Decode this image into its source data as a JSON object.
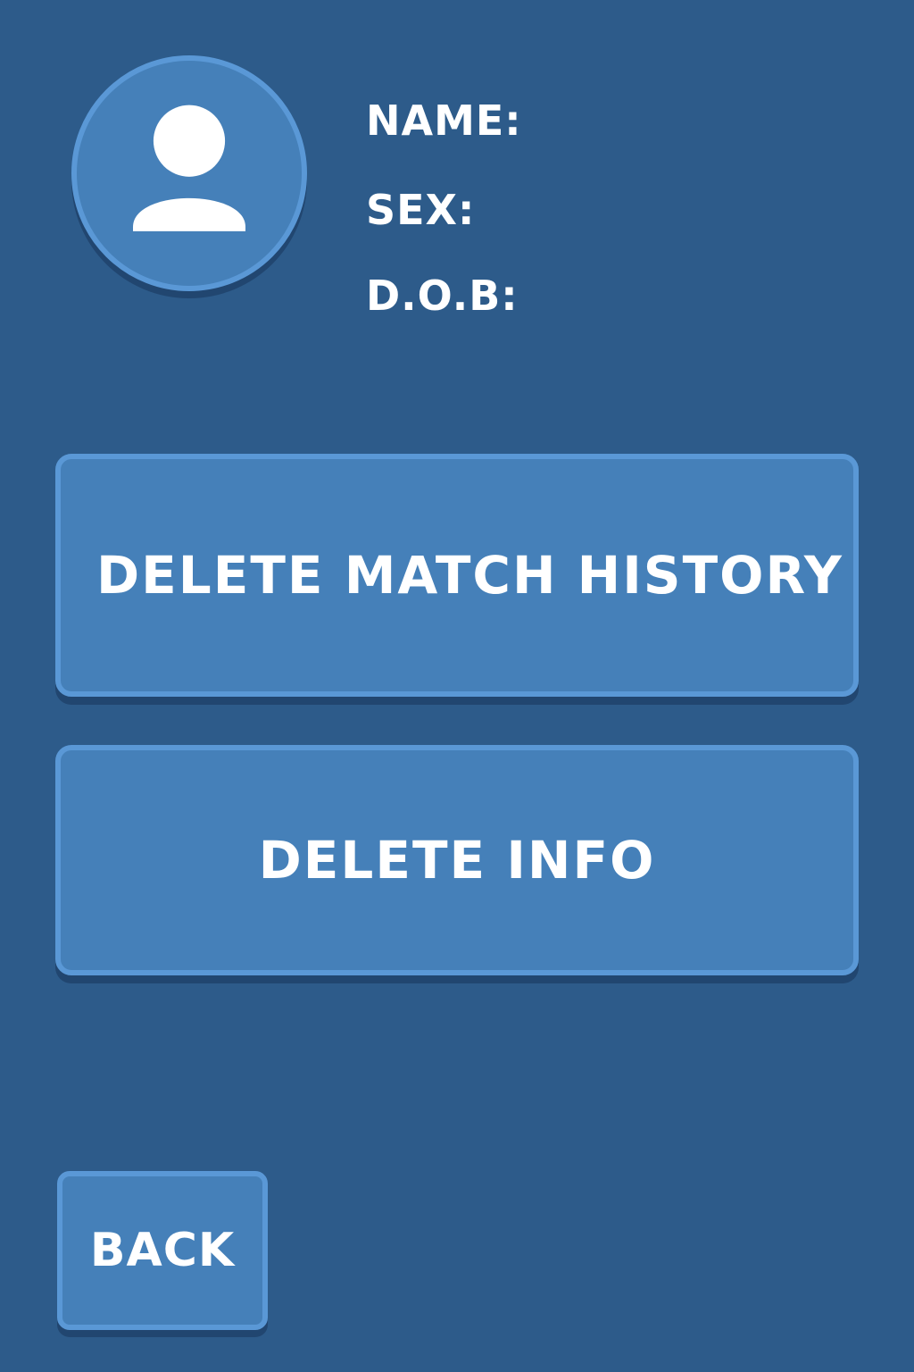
{
  "profile": {
    "avatar_icon": "user-icon",
    "fields": {
      "name_label": "NAME:",
      "sex_label": "SEX:",
      "dob_label": "D.O.B:"
    }
  },
  "actions": {
    "delete_match_history_label": "DELETE MATCH HISTORY",
    "delete_info_label": "DELETE INFO"
  },
  "navigation": {
    "back_label": "BACK"
  },
  "colors": {
    "background": "#2d5b8a",
    "button_fill": "#4580b9",
    "button_border": "#5a98d6",
    "text": "#ffffff"
  }
}
